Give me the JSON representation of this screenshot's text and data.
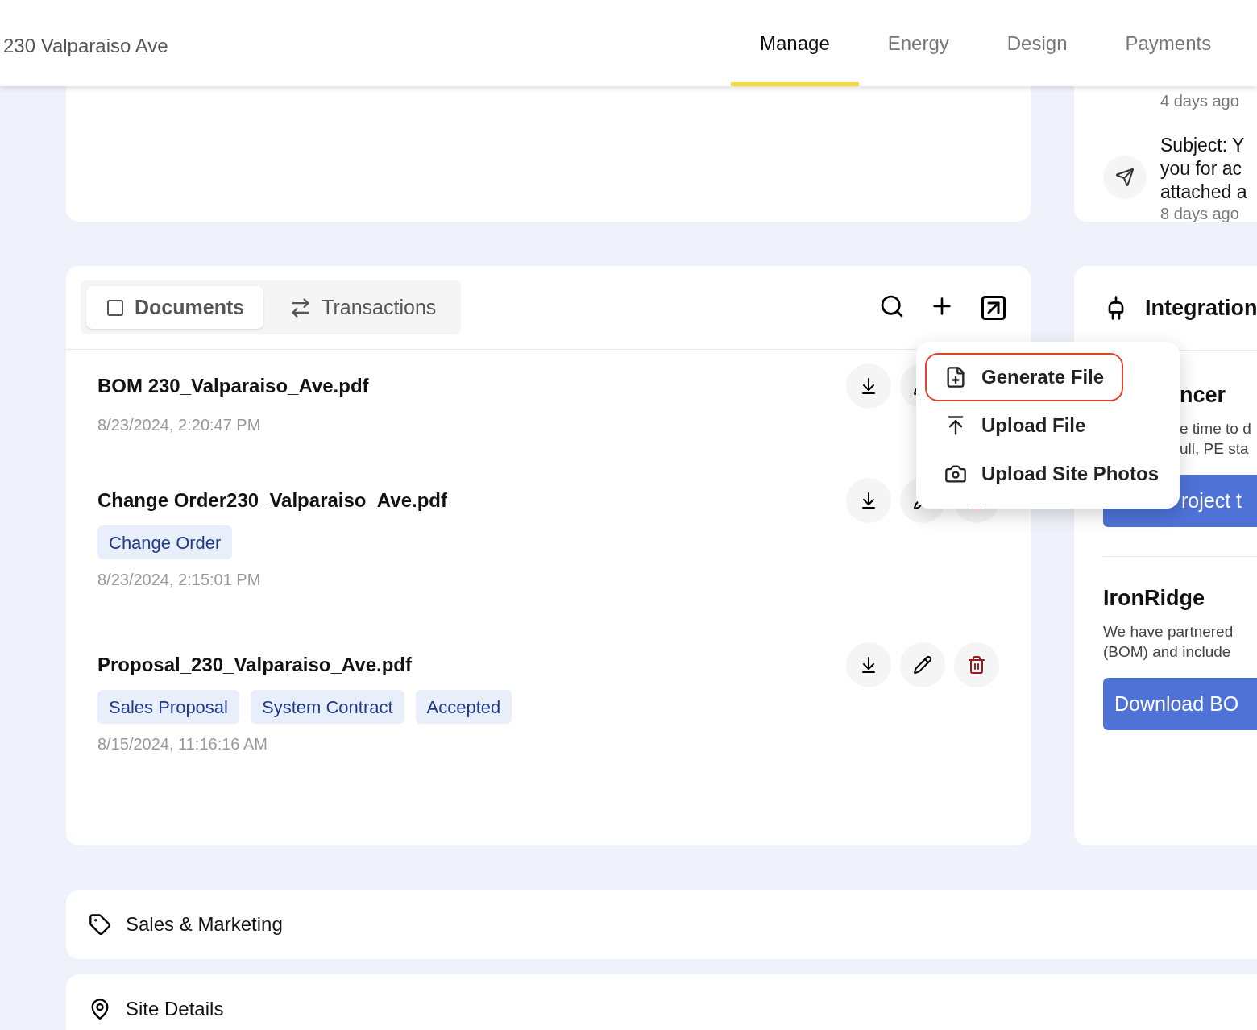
{
  "header": {
    "address": "230 Valparaiso Ave",
    "tabs": [
      {
        "label": "Manage",
        "selected": true
      },
      {
        "label": "Energy",
        "selected": false
      },
      {
        "label": "Design",
        "selected": false
      },
      {
        "label": "Payments",
        "selected": false
      }
    ]
  },
  "activity": {
    "first_time": "4 days ago",
    "message": {
      "lines": [
        "Subject: Y",
        "you for ac",
        "attached a"
      ],
      "time": "8 days ago"
    }
  },
  "documents": {
    "tabs": [
      {
        "label": "Documents",
        "kind": "documents",
        "selected": true
      },
      {
        "label": "Transactions",
        "kind": "transactions",
        "selected": false
      }
    ],
    "files": [
      {
        "name": "BOM 230_Valparaiso_Ave.pdf",
        "date": "8/23/2024, 2:20:47 PM",
        "actions": [
          {
            "kind": "download"
          },
          {
            "kind": "edit"
          }
        ]
      },
      {
        "name": "Change Order230_Valparaiso_Ave.pdf",
        "tags": [
          "Change Order"
        ],
        "date": "8/23/2024, 2:15:01 PM",
        "actions": [
          {
            "kind": "download"
          },
          {
            "kind": "edit"
          },
          {
            "kind": "delete"
          }
        ]
      },
      {
        "name": "Proposal_230_Valparaiso_Ave.pdf",
        "tags": [
          "Sales Proposal",
          "System Contract",
          "Accepted"
        ],
        "date": "8/15/2024, 11:16:16 AM",
        "actions": [
          {
            "kind": "download"
          },
          {
            "kind": "edit"
          },
          {
            "kind": "delete"
          }
        ]
      }
    ]
  },
  "menu": {
    "items": [
      {
        "label": "Generate File",
        "kind": "generate",
        "selected": true
      },
      {
        "label": "Upload File",
        "kind": "upload",
        "selected": false
      },
      {
        "label": "Upload Site Photos",
        "kind": "photos",
        "selected": false
      }
    ]
  },
  "integration": {
    "title": "Integration",
    "partners": [
      {
        "heading": "ncer",
        "lines": [
          "e time to d",
          "ull, PE sta"
        ],
        "button": "roject t",
        "covered": true
      },
      {
        "heading": "IronRidge",
        "lines": [
          "We have partnered",
          "(BOM) and include"
        ],
        "button": "Download BO",
        "covered": false
      }
    ]
  },
  "sections": [
    {
      "title": "Sales & Marketing",
      "kind": "tag"
    },
    {
      "title": "Site Details",
      "kind": "location"
    }
  ]
}
